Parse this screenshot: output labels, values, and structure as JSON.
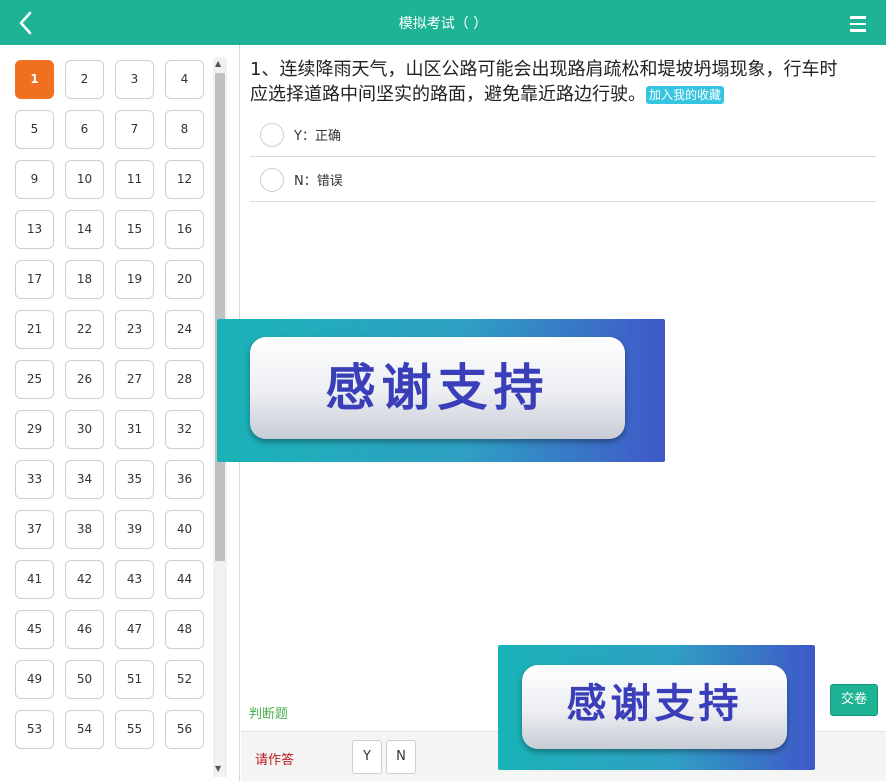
{
  "header": {
    "title": "模拟考试（ ）",
    "back_icon": "chevron-left-icon",
    "menu_icon": "hamburger-menu-icon",
    "color": "#1db394"
  },
  "question_nav": {
    "active": 1,
    "active_color": "#f07020",
    "numbers": [
      "1",
      "2",
      "3",
      "4",
      "5",
      "6",
      "7",
      "8",
      "9",
      "10",
      "11",
      "12",
      "13",
      "14",
      "15",
      "16",
      "17",
      "18",
      "19",
      "20",
      "21",
      "22",
      "23",
      "24",
      "25",
      "26",
      "27",
      "28",
      "29",
      "30",
      "31",
      "32",
      "33",
      "34",
      "35",
      "36",
      "37",
      "38",
      "39",
      "40",
      "41",
      "42",
      "43",
      "44",
      "45",
      "46",
      "47",
      "48",
      "49",
      "50",
      "51",
      "52",
      "53",
      "54",
      "55",
      "56"
    ]
  },
  "question": {
    "text": "1、连续降雨天气，山区公路可能会出现路肩疏松和堤坡坍塌现象，行车时应选择道路中间坚实的路面，避免靠近路边行驶。",
    "favorite_label": "加入我的收藏",
    "options": [
      {
        "text": "Y：正确"
      },
      {
        "text": "N：错误"
      }
    ],
    "type_label": "判断题"
  },
  "submit_label": "交卷",
  "answer_bar": {
    "prompt": "请作答",
    "buttons": [
      "Y",
      "N"
    ]
  },
  "watermark": {
    "text": "感谢支持"
  }
}
